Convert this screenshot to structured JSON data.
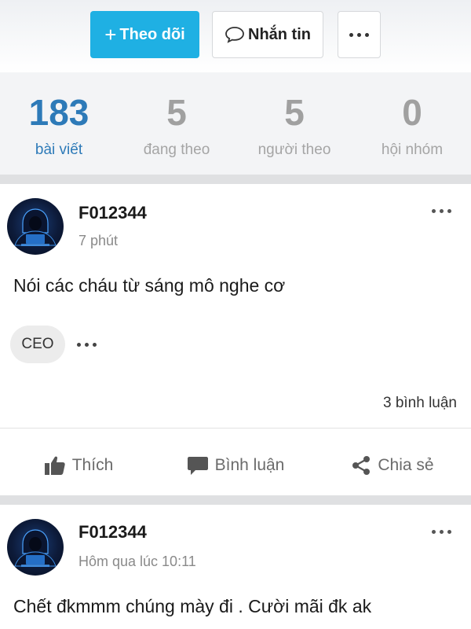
{
  "header": {
    "follow_label": "Theo dõi",
    "follow_plus": "+",
    "message_label": "Nhắn tin"
  },
  "stats": [
    {
      "value": "183",
      "label": "bài viết",
      "active": true
    },
    {
      "value": "5",
      "label": "đang theo",
      "active": false
    },
    {
      "value": "5",
      "label": "người theo",
      "active": false
    },
    {
      "value": "0",
      "label": "hội nhóm",
      "active": false
    }
  ],
  "posts": [
    {
      "author": "F012344",
      "time": "7 phút",
      "text": "Nói các cháu từ sáng mô nghe cơ",
      "tag": "CEO",
      "comment_count": "3 bình luận"
    },
    {
      "author": "F012344",
      "time": "Hôm qua lúc 10:11",
      "text": "Chết đkmmm chúng mày đi . Cười mãi đk ak"
    }
  ],
  "actions": {
    "like": "Thích",
    "comment": "Bình luận",
    "share": "Chia sẻ"
  },
  "colors": {
    "accent": "#1fb0e3",
    "active_stat": "#2d7ab8",
    "muted": "#a0a0a0"
  },
  "icons": {
    "more": "more-horizontal-icon",
    "message": "speech-bubble-icon",
    "like": "thumbs-up-icon",
    "comment": "comment-icon",
    "share": "share-icon"
  }
}
